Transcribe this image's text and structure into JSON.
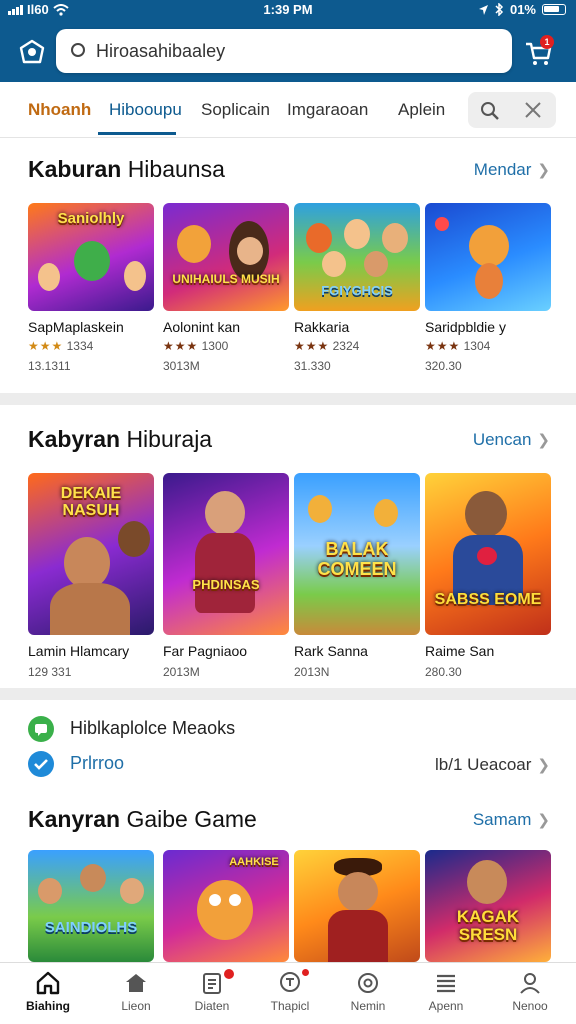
{
  "status_bar": {
    "carrier": "Il60",
    "time": "1:39 PM",
    "battery": "01%"
  },
  "search": {
    "value": "Hiroasahibaaley"
  },
  "header": {
    "cart_badge": "1"
  },
  "tabs": [
    {
      "label": "Nhoanh"
    },
    {
      "label": "Hibooupu"
    },
    {
      "label": "Soplicain"
    },
    {
      "label": "Imgaraoan"
    },
    {
      "label": "Aplein"
    }
  ],
  "section1": {
    "title_bold": "Kaburan",
    "title_rest": "Hibaunsa",
    "see_more": "Mendar",
    "cards": [
      {
        "title": "SapMaplaskein",
        "rating": "1334",
        "meta": "13.1311",
        "art_text": "Saniolhly"
      },
      {
        "title": "Aolonint kan",
        "rating": "1300",
        "meta": "3013M",
        "art_text": "UNIHAIULS MUSIH"
      },
      {
        "title": "Rakkaria",
        "rating": "2324",
        "meta": "31.330",
        "art_text": "FGIYGHCIS"
      },
      {
        "title": "Saridpbldie y",
        "rating": "1304",
        "meta": "320.30",
        "art_text": ""
      }
    ]
  },
  "section2": {
    "title_bold": "Kabyran",
    "title_rest": "Hiburaja",
    "see_more": "Uencan",
    "cards": [
      {
        "title": "Lamin Hlamcary",
        "meta": "129 331",
        "art_text": "DEKAIE NASUH"
      },
      {
        "title": "Far Pagniaoo",
        "meta": "2013M",
        "art_text": "PHDINSAS"
      },
      {
        "title": "Rark Sanna",
        "meta": "2013N",
        "art_text": "BALAK COMEEN"
      },
      {
        "title": "Raime San",
        "meta": "280.30",
        "art_text": "SABSS EOME"
      }
    ]
  },
  "info": {
    "row1_text": "Hiblkaplolce Meaoks",
    "row2_text": "Prlrroo",
    "row2_right": "lb/1 Ueacoar"
  },
  "section3": {
    "title_bold": "Kanyran",
    "title_rest": "Gaibe Game",
    "see_more": "Samam",
    "cards": [
      {
        "art_text": "SAINDIOLHS"
      },
      {
        "art_text": "AAHKISE"
      },
      {
        "art_text": ""
      },
      {
        "art_text": "KAGAK SRESN"
      }
    ]
  },
  "bottom_nav": [
    {
      "label": "Biahing"
    },
    {
      "label": "Lieon"
    },
    {
      "label": "Diaten"
    },
    {
      "label": "Thapicl"
    },
    {
      "label": "Nemin"
    },
    {
      "label": "Apenn"
    },
    {
      "label": "Nenoo"
    }
  ],
  "colors": {
    "header": "#0d5a8f",
    "accent": "#1f6fa8",
    "first_tab": "#c06a12",
    "badge": "#e02020"
  }
}
